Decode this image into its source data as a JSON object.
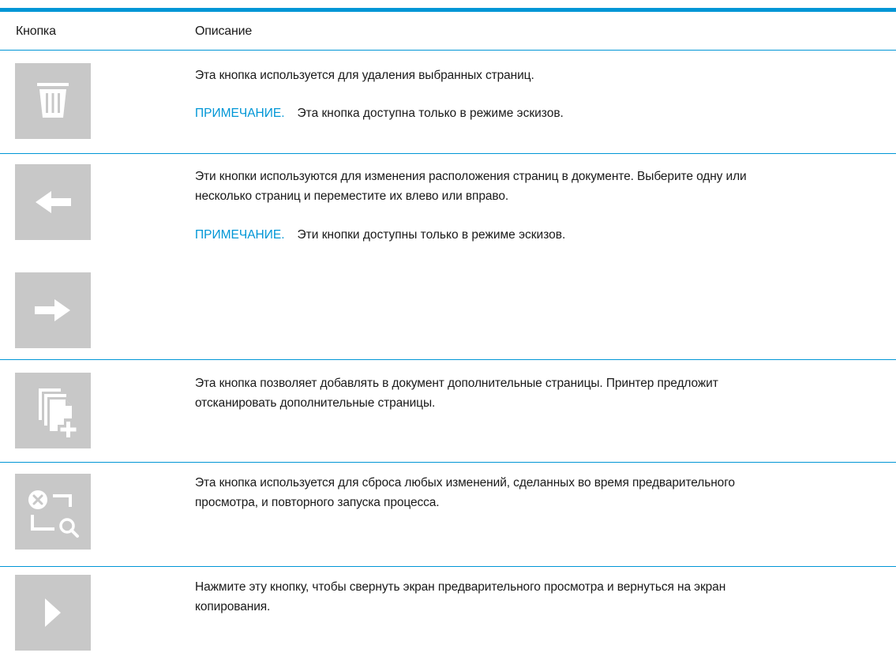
{
  "table": {
    "headers": {
      "button": "Кнопка",
      "description": "Описание"
    },
    "rows": [
      {
        "icon": "trash-icon",
        "description": "Эта кнопка используется для удаления выбранных страниц.",
        "note_label": "ПРИМЕЧАНИЕ.",
        "note_text": "Эта кнопка доступна только в режиме эскизов."
      },
      {
        "icon": "arrow-left-icon",
        "icon2": "arrow-right-icon",
        "description_line1": "Эти кнопки используются для изменения расположения страниц в документе. Выберите одну или",
        "description_line2": "несколько страниц и переместите их влево или вправо.",
        "note_label": "ПРИМЕЧАНИЕ.",
        "note_text": "Эти кнопки доступны только в режиме эскизов."
      },
      {
        "icon": "add-pages-icon",
        "description_line1": "Эта кнопка позволяет добавлять в документ дополнительные страницы. Принтер предложит",
        "description_line2": "отсканировать дополнительные страницы."
      },
      {
        "icon": "reset-preview-icon",
        "description_line1": "Эта кнопка используется для сброса любых изменений, сделанных во время предварительного",
        "description_line2": "просмотра, и повторного запуска процесса."
      },
      {
        "icon": "play-collapse-icon",
        "description_line1": "Нажмите эту кнопку, чтобы свернуть экран предварительного просмотра и вернуться на экран",
        "description_line2": "копирования."
      }
    ]
  },
  "colors": {
    "accent": "#0096d6",
    "icon_bg": "#c8c8c8",
    "icon_fg": "#ffffff",
    "text": "#1a1a1a"
  }
}
